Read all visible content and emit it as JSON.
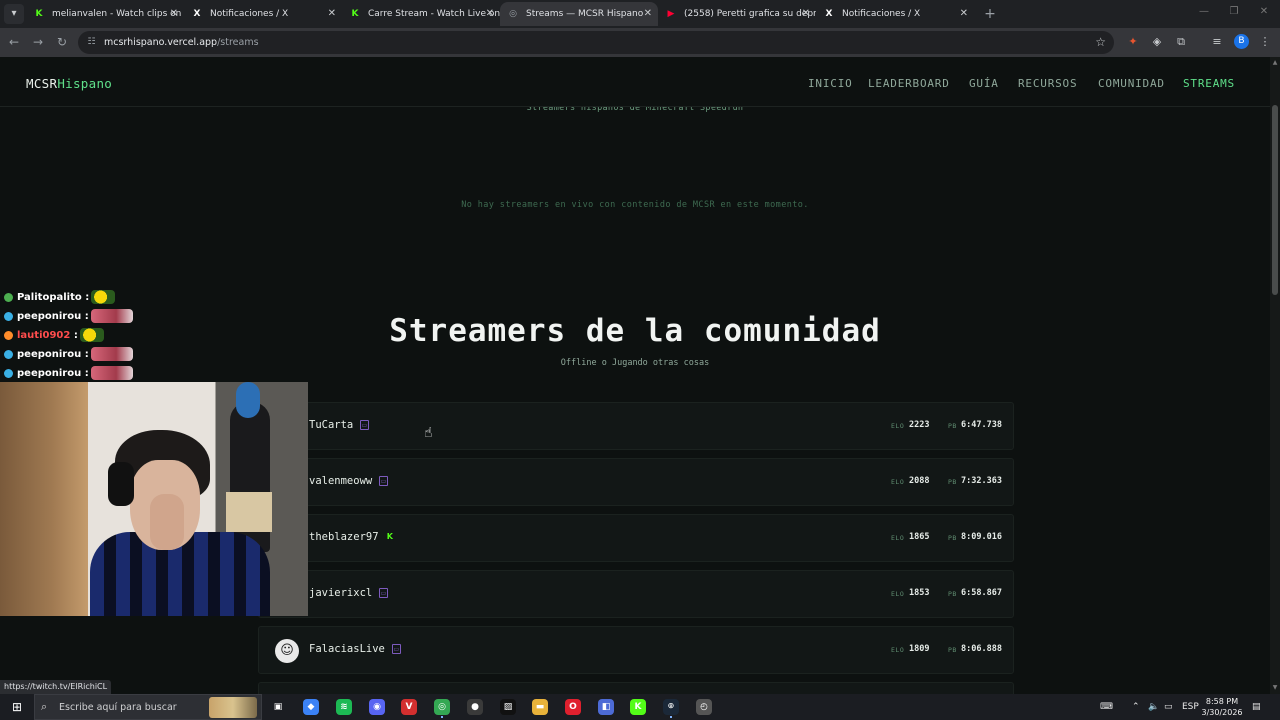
{
  "browser": {
    "tabs": [
      {
        "title": "melianvalen - Watch clips on Ki",
        "favicon": "K",
        "favicon_color": "#53fc18",
        "active": false
      },
      {
        "title": "Notificaciones / X",
        "favicon": "X",
        "favicon_color": "#ffffff",
        "active": false
      },
      {
        "title": "Carre Stream - Watch Live on Ki",
        "favicon": "K",
        "favicon_color": "#53fc18",
        "active": false
      },
      {
        "title": "Streams — MCSR Hispano",
        "favicon": "◎",
        "favicon_color": "#9aa0a6",
        "active": true
      },
      {
        "title": "(2558) Peretti grafica su depres",
        "favicon": "▶",
        "favicon_color": "#ff0033",
        "active": false
      },
      {
        "title": "Notificaciones / X",
        "favicon": "X",
        "favicon_color": "#ffffff",
        "active": false
      }
    ],
    "url_host": "mcsrhispano.vercel.app",
    "url_path": "/streams",
    "status_url": "https://twitch.tv/ElRichiCL"
  },
  "site": {
    "logo_main": "MCSR",
    "logo_accent": "Hispano",
    "nav": [
      {
        "label": "INICIO",
        "active": false
      },
      {
        "label": "LEADERBOARD",
        "active": false
      },
      {
        "label": "GUÍA",
        "active": false
      },
      {
        "label": "RECURSOS",
        "active": false
      },
      {
        "label": "COMUNIDAD",
        "active": false
      },
      {
        "label": "STREAMS",
        "active": true
      }
    ],
    "hero_subtitle": "Streamers hispanos de Minecraft Speedrun",
    "no_live_message": "No hay streamers en vivo con contenido de MCSR en este momento.",
    "community_title": "Streamers de la comunidad",
    "community_subtitle": "Offline o Jugando otras cosas",
    "elo_label": "ELO",
    "pb_label": "PB",
    "streamers": [
      {
        "name": "TuCarta",
        "platform": "twitch",
        "elo": "2223",
        "pb": "6:47.738"
      },
      {
        "name": "valenmeoww",
        "platform": "twitch",
        "elo": "2088",
        "pb": "7:32.363"
      },
      {
        "name": "theblazer97",
        "platform": "kick",
        "elo": "1865",
        "pb": "8:09.016"
      },
      {
        "name": "javierixcl",
        "platform": "twitch",
        "elo": "1853",
        "pb": "6:58.867"
      },
      {
        "name": "FalaciasLive",
        "platform": "twitch",
        "elo": "1809",
        "pb": "8:06.888",
        "avatar": "☺"
      }
    ]
  },
  "overlay": {
    "chat": [
      {
        "user": "Palitopalito",
        "color": "#ffffff",
        "badge": "#4caf50",
        "emote": "yellow"
      },
      {
        "user": "peeponirou",
        "color": "#ffffff",
        "badge": "#3ab0e5",
        "emote": "pink"
      },
      {
        "user": "lauti0902",
        "color": "#ff4d4d",
        "badge": "#ff8c2a",
        "emote": "yellow"
      },
      {
        "user": "peeponirou",
        "color": "#ffffff",
        "badge": "#3ab0e5",
        "emote": "pink"
      },
      {
        "user": "peeponirou",
        "color": "#ffffff",
        "badge": "#3ab0e5",
        "emote": "pink"
      }
    ],
    "chat_separator": " :"
  },
  "taskbar": {
    "search_placeholder": "Escribe aquí para buscar",
    "apps": [
      {
        "name": "task-view",
        "glyph": "▣",
        "color": "transparent"
      },
      {
        "name": "copilot",
        "glyph": "◆",
        "color": "#3b82f6"
      },
      {
        "name": "spotify",
        "glyph": "≋",
        "color": "#1db954"
      },
      {
        "name": "discord",
        "glyph": "◉",
        "color": "#5865f2"
      },
      {
        "name": "voicemod",
        "glyph": "V",
        "color": "#d32f2f"
      },
      {
        "name": "chrome",
        "glyph": "◎",
        "color": "#34a853"
      },
      {
        "name": "obs",
        "glyph": "●",
        "color": "#3a3a3a"
      },
      {
        "name": "capcut",
        "glyph": "▨",
        "color": "#111111"
      },
      {
        "name": "file-explorer",
        "glyph": "▬",
        "color": "#e8b23a"
      },
      {
        "name": "opera",
        "glyph": "O",
        "color": "#e0202e"
      },
      {
        "name": "app-launcher",
        "glyph": "◧",
        "color": "#4d6bd6"
      },
      {
        "name": "kick",
        "glyph": "K",
        "color": "#53fc18"
      },
      {
        "name": "steam",
        "glyph": "⌾",
        "color": "#1b2838"
      },
      {
        "name": "clock-app",
        "glyph": "◴",
        "color": "#555555"
      }
    ],
    "lang": "ESP",
    "time": "8:58 PM",
    "date": "3/30/2026"
  }
}
